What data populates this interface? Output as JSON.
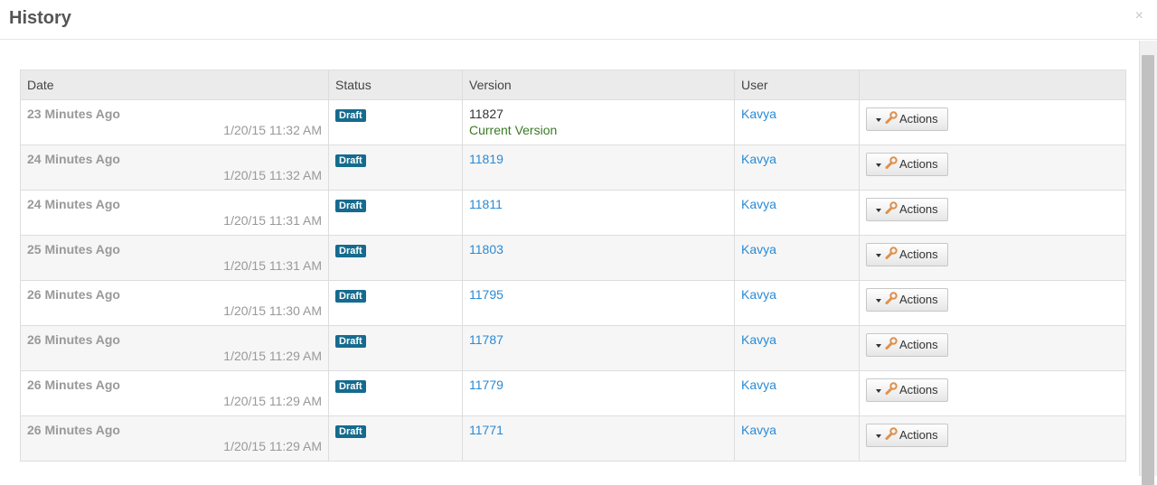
{
  "dialog": {
    "title": "History",
    "close_symbol": "×"
  },
  "table": {
    "headers": {
      "date": "Date",
      "status": "Status",
      "version": "Version",
      "user": "User",
      "actions": ""
    },
    "rows": [
      {
        "relative": "23 Minutes Ago",
        "timestamp": "1/20/15 11:32 AM",
        "status": "Draft",
        "version": "11827",
        "version_note": "Current Version",
        "user": "Kavya",
        "action": "Actions"
      },
      {
        "relative": "24 Minutes Ago",
        "timestamp": "1/20/15 11:32 AM",
        "status": "Draft",
        "version": "11819",
        "version_note": "",
        "user": "Kavya",
        "action": "Actions"
      },
      {
        "relative": "24 Minutes Ago",
        "timestamp": "1/20/15 11:31 AM",
        "status": "Draft",
        "version": "11811",
        "version_note": "",
        "user": "Kavya",
        "action": "Actions"
      },
      {
        "relative": "25 Minutes Ago",
        "timestamp": "1/20/15 11:31 AM",
        "status": "Draft",
        "version": "11803",
        "version_note": "",
        "user": "Kavya",
        "action": "Actions"
      },
      {
        "relative": "26 Minutes Ago",
        "timestamp": "1/20/15 11:30 AM",
        "status": "Draft",
        "version": "11795",
        "version_note": "",
        "user": "Kavya",
        "action": "Actions"
      },
      {
        "relative": "26 Minutes Ago",
        "timestamp": "1/20/15 11:29 AM",
        "status": "Draft",
        "version": "11787",
        "version_note": "",
        "user": "Kavya",
        "action": "Actions"
      },
      {
        "relative": "26 Minutes Ago",
        "timestamp": "1/20/15 11:29 AM",
        "status": "Draft",
        "version": "11779",
        "version_note": "",
        "user": "Kavya",
        "action": "Actions"
      },
      {
        "relative": "26 Minutes Ago",
        "timestamp": "1/20/15 11:29 AM",
        "status": "Draft",
        "version": "11771",
        "version_note": "",
        "user": "Kavya",
        "action": "Actions"
      }
    ]
  },
  "colors": {
    "badge": "#146b8e",
    "link": "#2a8ad4",
    "current_version": "#3a7a25"
  },
  "icons": {
    "close": "close-icon",
    "caret": "caret-down-icon",
    "wrench": "wrench-icon"
  }
}
